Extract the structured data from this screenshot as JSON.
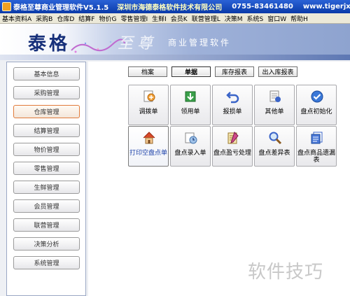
{
  "window": {
    "title": "泰格至尊商业管理软件V5.1.5",
    "company": "深圳市海德泰格软件技术有限公司",
    "phone": "0755-83461480",
    "website": "www.tigerjxc.c"
  },
  "menubar": [
    "基本资料A",
    "采购B",
    "仓库D",
    "结算F",
    "物价G",
    "零售管理I",
    "生鲜I",
    "会员K",
    "联营管理L",
    "决策M",
    "系统S",
    "窗口W",
    "帮助H"
  ],
  "banner": {
    "brand": "泰格",
    "sub_title": "至尊",
    "tagline": "商业管理软件"
  },
  "sidebar": {
    "items": [
      "基本信息",
      "采购管理",
      "仓库管理",
      "结算管理",
      "物价管理",
      "零售管理",
      "生鲜管理",
      "会员管理",
      "联营管理",
      "决策分析",
      "系统管理"
    ],
    "active_index": 2
  },
  "tabs": [
    "档案",
    "单据",
    "库存报表",
    "出入库报表"
  ],
  "active_tab": "单据",
  "functions": [
    {
      "label": "调拨单",
      "icon": "transfer-icon"
    },
    {
      "label": "领用单",
      "icon": "requisition-icon"
    },
    {
      "label": "报损单",
      "icon": "loss-report-icon"
    },
    {
      "label": "其他单",
      "icon": "other-doc-icon"
    },
    {
      "label": "盘点初始化",
      "icon": "check-init-icon"
    },
    {
      "label": "打印空盘点单",
      "icon": "print-blank-icon"
    },
    {
      "label": "盘点录入单",
      "icon": "stock-entry-icon"
    },
    {
      "label": "盘点盈亏处理",
      "icon": "profit-loss-icon"
    },
    {
      "label": "盘点差异表",
      "icon": "difference-icon"
    },
    {
      "label": "盘点商品遗漏表",
      "icon": "omission-icon"
    }
  ],
  "watermark": "软件技巧",
  "colors": {
    "title_bar": "#0a3aa8",
    "active_nav_border": "#e07a3a",
    "selected_text": "#1a3fa8"
  }
}
